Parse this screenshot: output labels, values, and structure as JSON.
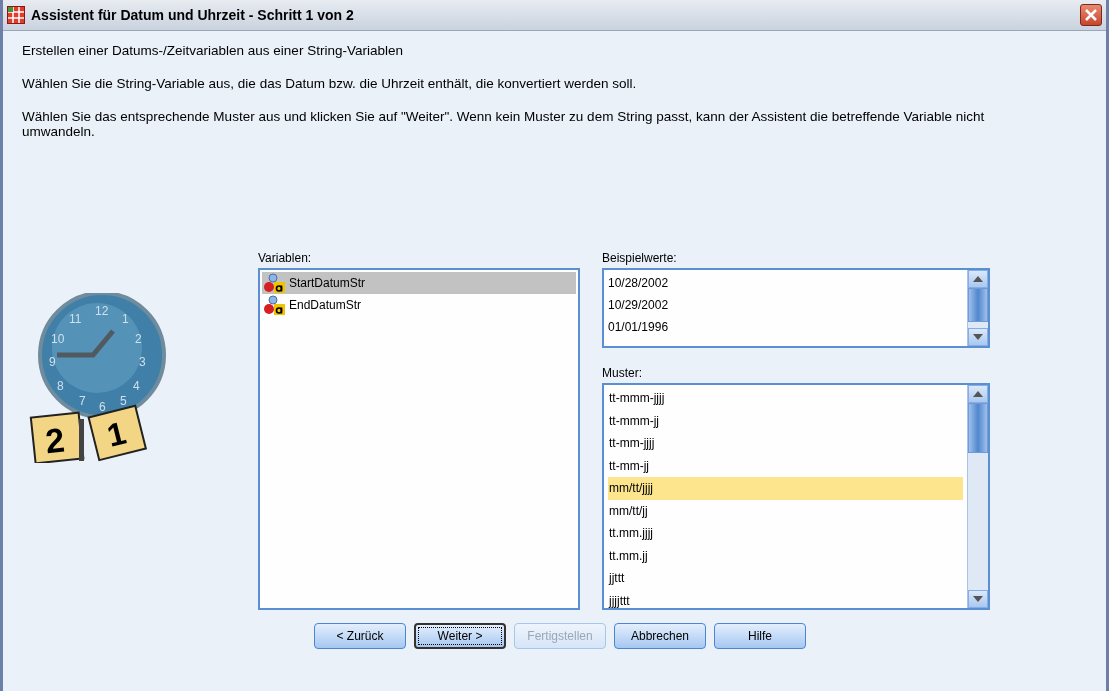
{
  "window": {
    "title": "Assistent für Datum und Uhrzeit - Schritt 1 von 2"
  },
  "intro": [
    "Erstellen einer Datums-/Zeitvariablen aus einer String-Variablen",
    "Wählen Sie die String-Variable aus, die das Datum bzw. die Uhrzeit enthält, die konvertiert werden soll.",
    "Wählen Sie das entsprechende Muster aus und klicken Sie auf \"Weiter\". Wenn kein Muster zu dem String passt, kann der Assistent die betreffende Variable nicht umwandeln."
  ],
  "clock": {
    "numerals": [
      "12",
      "1",
      "2",
      "3",
      "4",
      "5",
      "6",
      "7",
      "8",
      "9",
      "10",
      "11"
    ],
    "calendar_pages": [
      "2",
      "1"
    ]
  },
  "variables": {
    "label": "Variablen:",
    "items": [
      {
        "name": "StartDatumStr",
        "selected": true
      },
      {
        "name": "EndDatumStr",
        "selected": false
      }
    ]
  },
  "sample_values": {
    "label": "Beispielwerte:",
    "items": [
      "10/28/2002",
      "10/29/2002",
      "01/01/1996"
    ]
  },
  "patterns": {
    "label": "Muster:",
    "items": [
      {
        "text": "tt-mmm-jjjj",
        "selected": false
      },
      {
        "text": "tt-mmm-jj",
        "selected": false
      },
      {
        "text": "tt-mm-jjjj",
        "selected": false
      },
      {
        "text": "tt-mm-jj",
        "selected": false
      },
      {
        "text": "mm/tt/jjjj",
        "selected": true
      },
      {
        "text": "mm/tt/jj",
        "selected": false
      },
      {
        "text": "tt.mm.jjjj",
        "selected": false
      },
      {
        "text": "tt.mm.jj",
        "selected": false
      },
      {
        "text": "jjttt",
        "selected": false
      },
      {
        "text": "jjjjttt",
        "selected": false
      }
    ]
  },
  "buttons": [
    {
      "label": "< Zurück",
      "default": false,
      "disabled": false
    },
    {
      "label": "Weiter >",
      "default": true,
      "disabled": false
    },
    {
      "label": "Fertigstellen",
      "default": false,
      "disabled": true
    },
    {
      "label": "Abbrechen",
      "default": false,
      "disabled": false
    },
    {
      "label": "Hilfe",
      "default": false,
      "disabled": false
    }
  ]
}
